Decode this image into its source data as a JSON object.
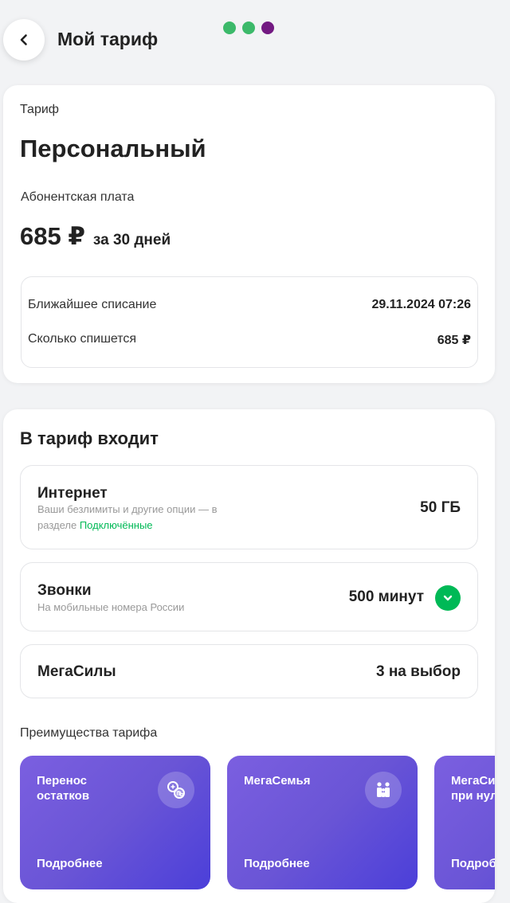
{
  "header": {
    "title": "Мой тариф"
  },
  "dots": [
    "#3cb96a",
    "#3cb96a",
    "#731982"
  ],
  "tariff": {
    "label": "Тариф",
    "name": "Персональный",
    "fee_label": "Абонентская плата",
    "price": "685 ₽",
    "period": "за 30 дней",
    "next_charge_label": "Ближайшее списание",
    "next_charge_value": "29.11.2024 07:26",
    "amount_label": "Сколько спишется",
    "amount_value": "685 ₽"
  },
  "included": {
    "title": "В тариф входит",
    "internet": {
      "title": "Интернет",
      "sub": "Ваши безлимиты и другие опции — в разделе",
      "link": "Подключённые",
      "value": "50 ГБ"
    },
    "calls": {
      "title": "Звонки",
      "sub": "На мобильные номера России",
      "value": "500 минут"
    },
    "megasily": {
      "title": "МегаСилы",
      "value": "3 на выбор"
    }
  },
  "advantages": {
    "label": "Преимущества тарифа",
    "cards": [
      {
        "title": "Перенос остатков",
        "more": "Подробнее"
      },
      {
        "title": "МегаСемья",
        "more": "Подробнее"
      },
      {
        "title": "МегаСилы «Связь при нуле»",
        "more": "Подробнее"
      }
    ]
  },
  "colors": {
    "accent_green": "#00b956",
    "purple": "#731982"
  }
}
